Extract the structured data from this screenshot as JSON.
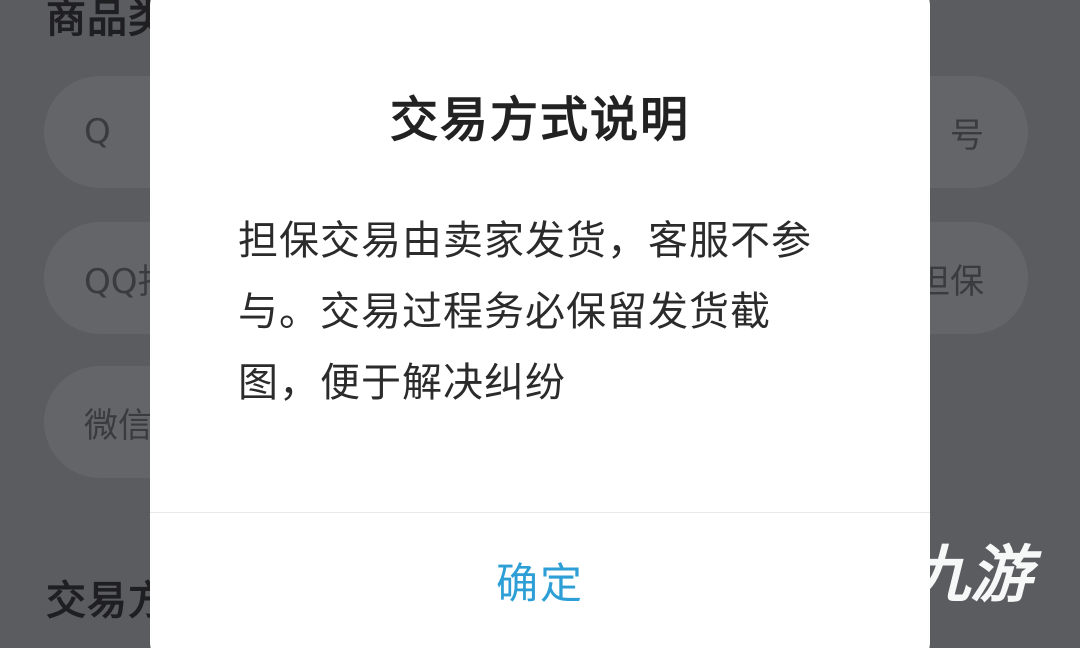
{
  "background": {
    "section_1_title": "商品类",
    "section_2_title": "交易方",
    "chips": [
      {
        "left": "Q",
        "right": "号"
      },
      {
        "left": "QQ扫",
        "right": "担保"
      },
      {
        "left": "微信",
        "right": ""
      }
    ]
  },
  "dialog": {
    "title": "交易方式说明",
    "body": "担保交易由卖家发货，客服不参与。交易过程务必保留发货截图，便于解决纠纷",
    "confirm_label": "确定"
  },
  "watermark": {
    "text": "九游"
  },
  "colors": {
    "accent": "#2d9fd6",
    "dialog_bg": "#ffffff",
    "overlay_bg": "#5b5c60"
  }
}
